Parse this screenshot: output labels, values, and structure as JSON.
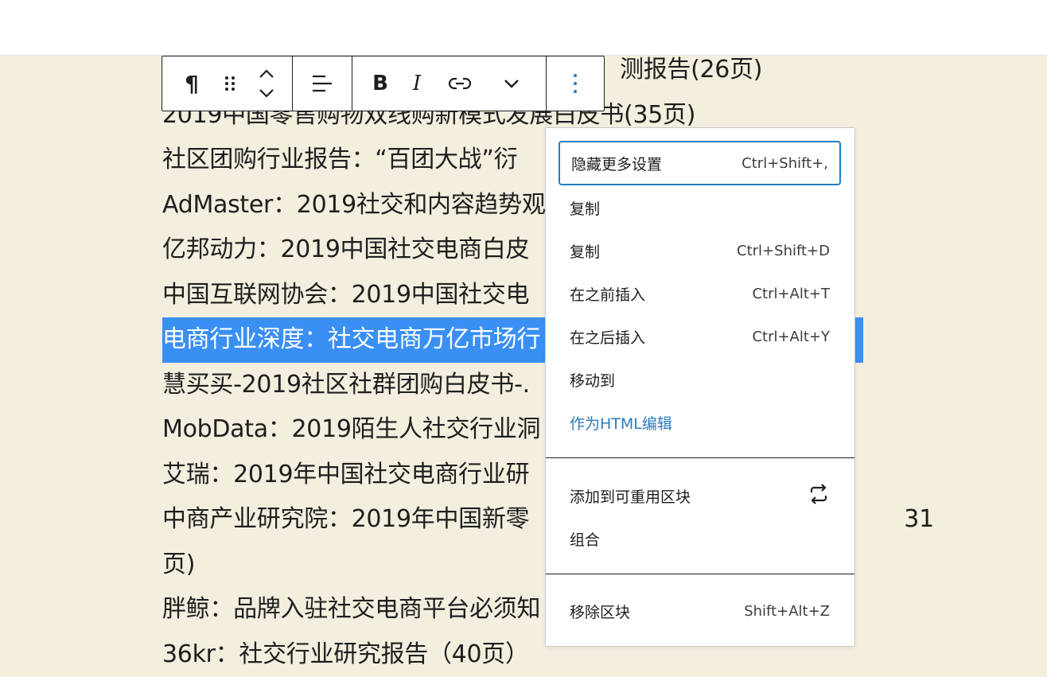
{
  "content_lines": [
    "2019中国零售购物双线购新模式发展白皮书(35页)",
    "社区团购行业报告：“百团大战”衍",
    "AdMaster：2019社交和内容趋势观",
    "亿邦动力：2019中国社交电商白皮",
    "中国互联网协会：2019中国社交电",
    "电商行业深度：社交电商万亿市场行",
    "慧买买-2019社区社群团购白皮书-.",
    "MobData：2019陌生人社交行业洞",
    "艾瑞：2019年中国社交电商行业研",
    "中商产业研究院：2019年中国新零                                                   31",
    "页)",
    "胖鲸：品牌入驻社交电商平台必须知",
    "36kr：社交行业研究报告（40页）"
  ],
  "partial_top_line": "测报告(26页)",
  "toolbar": {
    "paragraph_icon": "¶",
    "drag_icon": "drag-handle-icon",
    "move_icon": "chevron-up-down-icon",
    "align_icon": "align-icon",
    "bold_label": "B",
    "italic_label": "I",
    "link_icon": "link-icon",
    "more_formats_icon": "chevron-down-icon",
    "options_icon": "vertical-ellipsis-icon"
  },
  "menu": {
    "items": [
      {
        "label": "隐藏更多设置",
        "shortcut": "Ctrl+Shift+,"
      },
      {
        "label": "复制",
        "shortcut": ""
      },
      {
        "label": "复制",
        "shortcut": "Ctrl+Shift+D"
      },
      {
        "label": "在之前插入",
        "shortcut": "Ctrl+Alt+T"
      },
      {
        "label": "在之后插入",
        "shortcut": "Ctrl+Alt+Y"
      },
      {
        "label": "移动到",
        "shortcut": ""
      },
      {
        "label": "作为HTML编辑",
        "shortcut": ""
      }
    ],
    "group2": [
      {
        "label": "添加到可重用区块",
        "icon": "reusable-block-icon"
      },
      {
        "label": "组合",
        "shortcut": ""
      }
    ],
    "group3": [
      {
        "label": "移除区块",
        "shortcut": "Shift+Alt+Z"
      }
    ]
  },
  "colors": {
    "background": "#f4eedf",
    "selection": "#3a8ff5",
    "focus_border": "#1f7fbf",
    "html_link": "#2b7bbf"
  }
}
